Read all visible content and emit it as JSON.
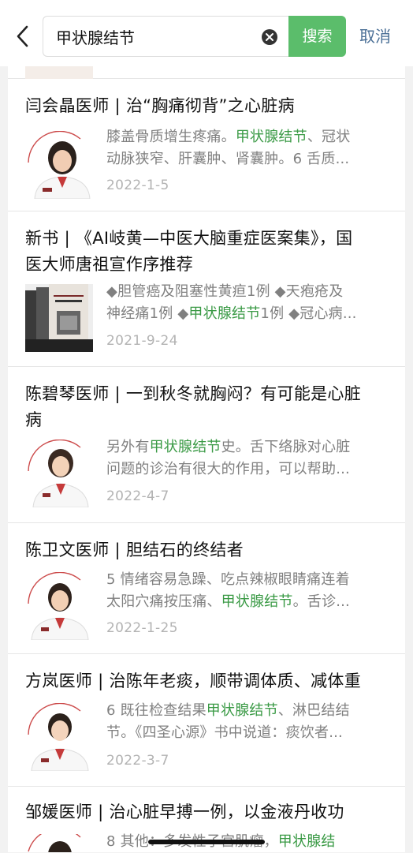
{
  "search": {
    "query": "甲状腺结节",
    "button_label": "搜索",
    "cancel_label": "取消"
  },
  "accent_color": "#3a9a45",
  "results": [
    {
      "title": "闫会晶医师 | 治“胸痛彻背”之心脏病",
      "snippet_lines": [
        [
          "膝盖骨质增生疼痛。",
          "甲状腺结节",
          "、冠状"
        ],
        [
          "动脉狭窄、肝囊肿、肾囊肿。6 舌质..."
        ]
      ],
      "date": "2022-1-5",
      "thumb": "doctor-portrait"
    },
    {
      "title_lines": [
        "新书 | 《AI岐黄—中医大脑重症医案集》，国",
        "医大师唐祖宣作序推荐"
      ],
      "snippet_lines": [
        [
          "◆胆管癌及阻塞性黄疸1例 ◆天疱疮及"
        ],
        [
          "神经痛1例 ◆",
          "甲状腺结节",
          "1例 ◆冠心病..."
        ]
      ],
      "date": "2021-9-24",
      "thumb": "book-cover"
    },
    {
      "title_lines": [
        "陈碧琴医师 | 一到秋冬就胸闷？有可能是心脏",
        "病"
      ],
      "snippet_lines": [
        [
          "另外有",
          "甲状腺结节",
          "史。舌下络脉对心脏"
        ],
        [
          "问题的诊治有很大的作用，可以帮助..."
        ]
      ],
      "date": "2022-4-7",
      "thumb": "doctor-portrait"
    },
    {
      "title": "陈卫文医师 | 胆结石的终结者",
      "snippet_lines": [
        [
          "5 情绪容易急躁、吃点辣椒眼睛痛连着"
        ],
        [
          "太阳穴痛按压痛、",
          "甲状腺结节",
          "。舌诊..."
        ]
      ],
      "date": "2022-1-25",
      "thumb": "doctor-portrait"
    },
    {
      "title": "方岚医师 | 治陈年老痰，顺带调体质、减体重",
      "snippet_lines": [
        [
          "6 既往检查结果",
          "甲状腺结节",
          "、淋巴结结"
        ],
        [
          "节。《四圣心源》书中说道：痰饮者..."
        ]
      ],
      "date": "2022-3-7",
      "thumb": "doctor-portrait"
    },
    {
      "title": "邹媛医师 | 治心脏早搏一例，以金液丹收功",
      "snippet_lines": [
        [
          "8 其他：多发性子宫肌瘤，",
          "甲状腺结"
        ]
      ],
      "date": "",
      "thumb": "doctor-portrait"
    }
  ]
}
